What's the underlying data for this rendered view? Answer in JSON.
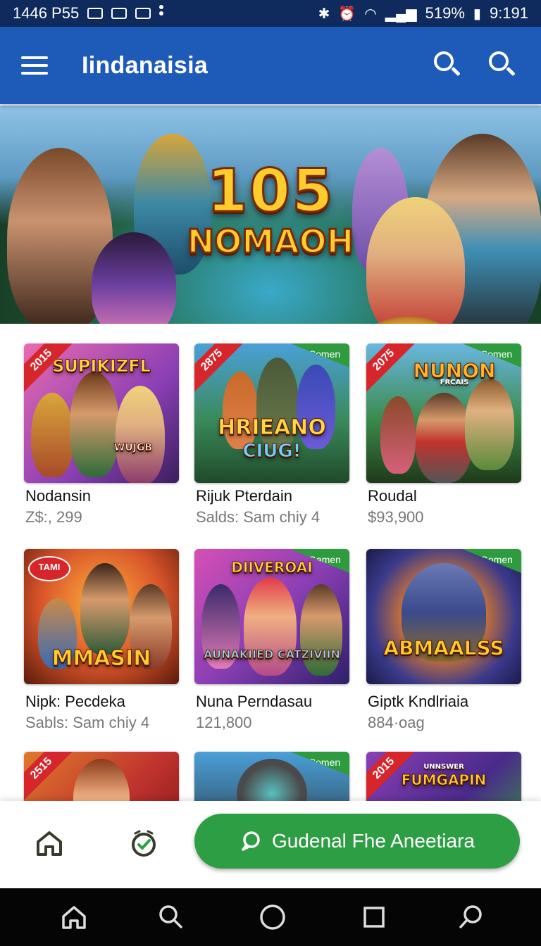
{
  "status_bar": {
    "left_text": "1446 P55",
    "battery": "519%",
    "time": "9:191"
  },
  "app_bar": {
    "title": "Iindanaisia"
  },
  "hero": {
    "title_line1": "105",
    "title_line2": "NOMAOH"
  },
  "games": [
    {
      "name": "Nodansin",
      "sub": "Z$:, 299",
      "ribbon": "2015",
      "tag": "",
      "thumb_title": "SUPIKIZFL",
      "thumb_sub": "WUJGB"
    },
    {
      "name": "Rijuk Pterdain",
      "sub": "Salds: Sam chiy 4",
      "ribbon": "2875",
      "tag": "Somen",
      "thumb_title": "HRIEANO",
      "thumb_sub": "CIUG!"
    },
    {
      "name": "Roudal",
      "sub": "$93,900",
      "ribbon": "2075",
      "tag": "Somen",
      "thumb_title": "NUNON",
      "thumb_sub": "FRCAIS"
    },
    {
      "name": "Nipk: Pecdeka",
      "sub": "Sabls: Sam chiy 4",
      "ribbon": "",
      "tag": "",
      "bubble": "TAMI",
      "thumb_title": "MMASIN",
      "thumb_sub": ""
    },
    {
      "name": "Nuna Perndasau",
      "sub": "121,800",
      "ribbon": "",
      "tag": "Gamen",
      "thumb_title": "DIIVEROAI",
      "thumb_sub": "AUNAKIIED CATZIVIIN"
    },
    {
      "name": "Giptk Kndlriaia",
      "sub": "884·oag",
      "ribbon": "",
      "tag": "Gomen",
      "thumb_title": "ABMAALSS",
      "thumb_sub": ""
    },
    {
      "name": "",
      "sub": "",
      "ribbon": "2515",
      "tag": "",
      "thumb_title": "",
      "thumb_sub": ""
    },
    {
      "name": "",
      "sub": "",
      "ribbon": "",
      "tag": "Somen",
      "thumb_title": "",
      "thumb_sub": ""
    },
    {
      "name": "",
      "sub": "",
      "ribbon": "2015",
      "tag": "",
      "thumb_title": "FUMGAPIN",
      "thumb_sub": "UNNSWER"
    }
  ],
  "action_bar": {
    "cta_label": "Gudenal Fhe Aneetiara"
  },
  "colors": {
    "app_bar": "#1e5bb8",
    "status_bar": "#0f2a5c",
    "cta": "#2e9e45",
    "ribbon": "#d6262b",
    "tag": "#2e9b3e"
  },
  "icons": [
    "menu-icon",
    "search-icon",
    "home-icon",
    "clock-check-icon",
    "chat-bubble-icon",
    "circle-home-icon",
    "square-recents-icon"
  ]
}
